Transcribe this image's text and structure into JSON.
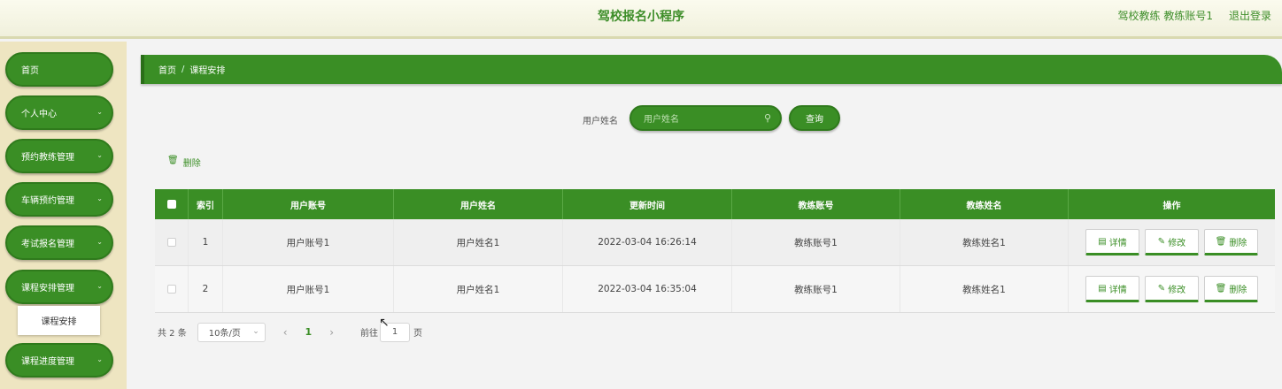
{
  "header": {
    "title": "驾校报名小程序",
    "user": "驾校教练 教练账号1",
    "logout": "退出登录"
  },
  "sidebar": {
    "items": [
      {
        "label": "首页"
      },
      {
        "label": "个人中心"
      },
      {
        "label": "预约教练管理"
      },
      {
        "label": "车辆预约管理"
      },
      {
        "label": "考试报名管理"
      },
      {
        "label": "课程安排管理"
      },
      {
        "label": "课程进度管理"
      }
    ],
    "submenu": {
      "label": "课程安排"
    }
  },
  "breadcrumb": {
    "home": "首页",
    "sep": "/",
    "current": "课程安排"
  },
  "search": {
    "label": "用户姓名",
    "placeholder": "用户姓名",
    "button": "查询"
  },
  "toolbar": {
    "delete_label": "删除"
  },
  "table": {
    "columns": [
      "索引",
      "用户账号",
      "用户姓名",
      "更新时间",
      "教练账号",
      "教练姓名",
      "操作"
    ],
    "rows": [
      {
        "index": "1",
        "account": "用户账号1",
        "name": "用户姓名1",
        "time": "2022-03-04 16:26:14",
        "coach_account": "教练账号1",
        "coach_name": "教练姓名1"
      },
      {
        "index": "2",
        "account": "用户账号1",
        "name": "用户姓名1",
        "time": "2022-03-04 16:35:04",
        "coach_account": "教练账号1",
        "coach_name": "教练姓名1"
      }
    ],
    "actions": {
      "detail": "详情",
      "edit": "修改",
      "delete": "删除"
    }
  },
  "pagination": {
    "total": "共 2 条",
    "page_size": "10条/页",
    "current_page": "1",
    "goto_prefix": "前往",
    "goto_value": "1",
    "goto_suffix": "页"
  },
  "colors": {
    "primary": "#3a8e25",
    "sidebar_bg": "#eee5c1",
    "header_bg": "#fbfbee"
  }
}
